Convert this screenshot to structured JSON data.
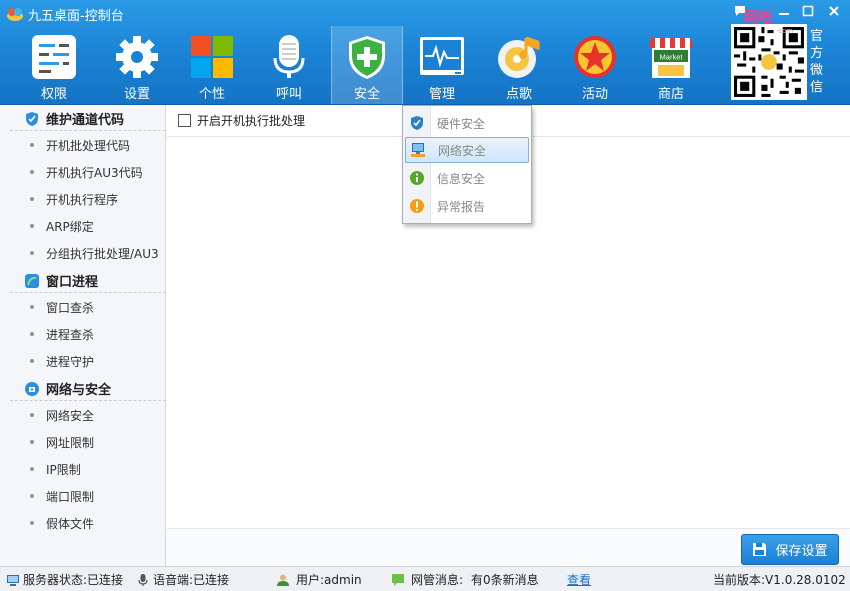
{
  "app": {
    "title": "九五桌面-控制台"
  },
  "header": {
    "toolbar": [
      {
        "id": "permissions",
        "label": "权限",
        "icon": "sliders-icon"
      },
      {
        "id": "settings",
        "label": "设置",
        "icon": "gear-icon"
      },
      {
        "id": "personal",
        "label": "个性",
        "icon": "tiles-icon"
      },
      {
        "id": "call",
        "label": "呼叫",
        "icon": "microphone-icon"
      },
      {
        "id": "security",
        "label": "安全",
        "icon": "shield-icon",
        "active": true
      },
      {
        "id": "manage",
        "label": "管理",
        "icon": "monitor-icon"
      },
      {
        "id": "music",
        "label": "点歌",
        "icon": "cd-music-icon"
      },
      {
        "id": "activity",
        "label": "活动",
        "icon": "star-badge-icon"
      },
      {
        "id": "shop",
        "label": "商店",
        "icon": "market-icon",
        "sign": "Market"
      }
    ],
    "wechat_label": "官方微信",
    "badge_text": "网吧",
    "badge_subtext": "·com"
  },
  "sidebar": {
    "groups": [
      {
        "title": "维护通道代码",
        "icon": "shield-check-icon",
        "items": [
          "开机批处理代码",
          "开机执行AU3代码",
          "开机执行程序",
          "ARP绑定",
          "分组执行批处理/AU3"
        ]
      },
      {
        "title": "窗口进程",
        "icon": "window-icon",
        "items": [
          "窗口查杀",
          "进程查杀",
          "进程守护"
        ]
      },
      {
        "title": "网络与安全",
        "icon": "network-icon",
        "items": [
          "网络安全",
          "网址限制",
          "IP限制",
          "端口限制",
          "假体文件"
        ]
      }
    ]
  },
  "main": {
    "option_label": "开启开机执行批处理",
    "option_checked": false,
    "save_label": "保存设置"
  },
  "dropdown": {
    "items": [
      {
        "label": "硬件安全",
        "icon": "hardware-shield-icon"
      },
      {
        "label": "网络安全",
        "icon": "network-computer-icon",
        "hover": true
      },
      {
        "label": "信息安全",
        "icon": "info-icon"
      },
      {
        "label": "异常报告",
        "icon": "warning-icon"
      }
    ]
  },
  "statusbar": {
    "server": "服务器状态:已连接",
    "voice": "语音端:已连接",
    "user": "用户:admin",
    "message_label": "网管消息:",
    "message_value": "有0条新消息",
    "view_link": "查看",
    "version": "当前版本:V1.0.28.0102"
  },
  "colors": {
    "header_blue": "#1a82d4",
    "save_button": "#2a8fe0",
    "link": "#1a6fc6"
  }
}
